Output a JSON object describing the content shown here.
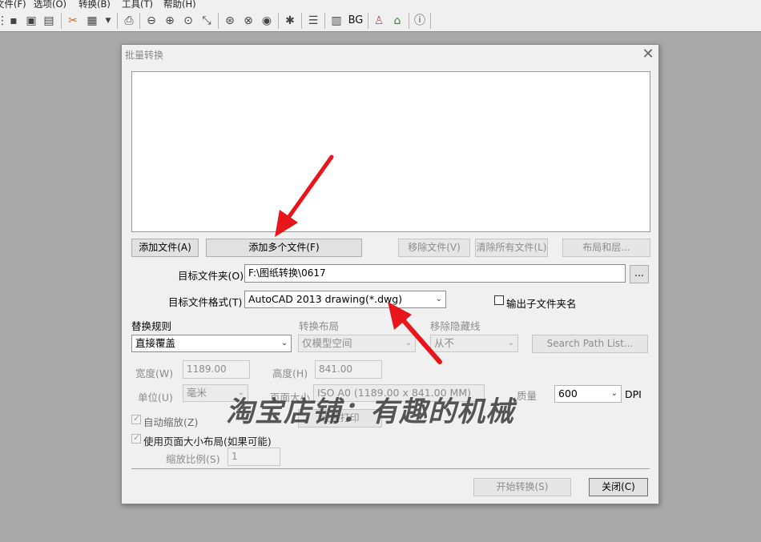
{
  "menu": [
    "文件(F)",
    "选项(O)",
    "转换(B)",
    "工具(T)",
    "帮助(H)"
  ],
  "toolbar": {
    "icons": [
      "save-icon",
      "save-all-icon",
      "export-icon",
      "convert-icon",
      "batch-icon",
      "print-icon",
      "zoom-out-icon",
      "zoom-in-icon",
      "zoom-window-icon",
      "zoom-extents-icon",
      "zoom-previous-icon",
      "pan-icon",
      "view-icon",
      "settings-icon",
      "layers-icon",
      "layout-icon"
    ],
    "bg_label": "BG"
  },
  "dialog": {
    "title": "批量转换",
    "buttons": {
      "add_file": "添加文件(A)",
      "add_multiple": "添加多个文件(F)",
      "remove_file": "移除文件(V)",
      "clear_all": "清除所有文件(L)",
      "layout_layers": "布局和层...",
      "browse": "...",
      "search_path": "Search Path List...",
      "print_settings": "设置打印",
      "start": "开始转换(S)",
      "close": "关闭(C)"
    },
    "target_folder": {
      "label": "目标文件夹(O)",
      "value": "F:\\图纸转换\\0617"
    },
    "target_format": {
      "label": "目标文件格式(T)",
      "value": "AutoCAD 2013 drawing(*.dwg)"
    },
    "output_subfolder": {
      "label": "输出子文件夹名",
      "checked": false
    },
    "replace_rule": {
      "label": "替换规则",
      "value": "直接覆盖"
    },
    "convert_layout": {
      "label": "转换布局",
      "value": "仅模型空间"
    },
    "remove_hidden": {
      "label": "移除隐藏线",
      "value": "从不"
    },
    "width": {
      "label": "宽度(W)",
      "value": "1189.00"
    },
    "height": {
      "label": "高度(H)",
      "value": "841.00"
    },
    "unit": {
      "label": "单位(U)",
      "value": "毫米"
    },
    "page_size": {
      "label": "页面大小",
      "value": "ISO A0 (1189.00 x 841.00 MM)"
    },
    "quality": {
      "label": "质量",
      "value": "600",
      "unit": "DPI"
    },
    "auto_zoom": {
      "label": "自动缩放(Z)",
      "checked": true
    },
    "use_page_size": {
      "label": "使用页面大小布局(如果可能)",
      "checked": true
    },
    "scale": {
      "label": "缩放比例(S)",
      "value": "1"
    }
  },
  "watermark": "淘宝店铺：有趣的机械",
  "colors": {
    "arrow": "#e8161b",
    "background": "#a9a9a9",
    "dialog": "#f0f0f0"
  }
}
